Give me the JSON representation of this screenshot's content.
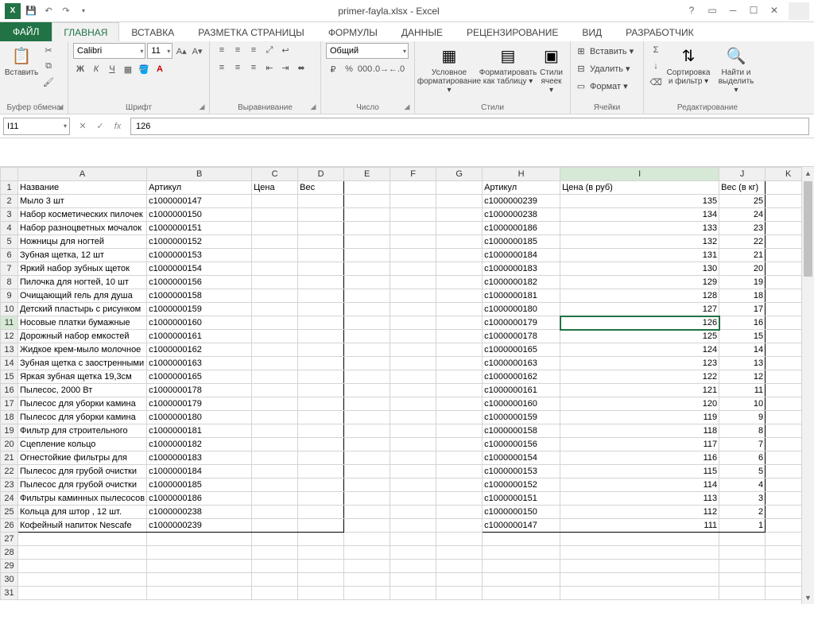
{
  "title": "primer-fayla.xlsx - Excel",
  "tabs": {
    "file": "ФАЙЛ",
    "list": [
      "ГЛАВНАЯ",
      "ВСТАВКА",
      "РАЗМЕТКА СТРАНИЦЫ",
      "ФОРМУЛЫ",
      "ДАННЫЕ",
      "РЕЦЕНЗИРОВАНИЕ",
      "ВИД",
      "РАЗРАБОТЧИК"
    ],
    "active": 0
  },
  "ribbon": {
    "clipboard": {
      "paste": "Вставить",
      "title": "Буфер обмена"
    },
    "font": {
      "name": "Calibri",
      "size": "11",
      "title": "Шрифт"
    },
    "align": {
      "title": "Выравнивание"
    },
    "number": {
      "format": "Общий",
      "title": "Число"
    },
    "styles": {
      "cond": "Условное форматирование ▾",
      "table": "Форматировать как таблицу ▾",
      "cell": "Стили ячеек ▾",
      "title": "Стили"
    },
    "cells": {
      "insert": "Вставить ▾",
      "delete": "Удалить ▾",
      "format": "Формат ▾",
      "title": "Ячейки"
    },
    "editing": {
      "sort": "Сортировка и фильтр ▾",
      "find": "Найти и выделить ▾",
      "title": "Редактирование"
    }
  },
  "namebox": "I11",
  "formula": "126",
  "columns": [
    "A",
    "B",
    "C",
    "D",
    "E",
    "F",
    "G",
    "H",
    "I",
    "J",
    "K"
  ],
  "headers1": {
    "A": "Название",
    "B": "Артикул",
    "C": "Цена",
    "D": "Вес"
  },
  "headers2": {
    "H": "Артикул",
    "I": "Цена (в руб)",
    "J": "Вес (в кг)"
  },
  "left_rows": [
    [
      "Мыло 3 шт",
      "c1000000147"
    ],
    [
      "Набор косметических пилочек",
      "c1000000150"
    ],
    [
      "Набор разноцветных мочалок",
      "c1000000151"
    ],
    [
      "Ножницы для ногтей",
      "c1000000152"
    ],
    [
      "Зубная щетка, 12 шт",
      "c1000000153"
    ],
    [
      "Яркий набор зубных щеток",
      "c1000000154"
    ],
    [
      "Пилочка для ногтей, 10 шт",
      "c1000000156"
    ],
    [
      "Очищающий гель для душа",
      "c1000000158"
    ],
    [
      "Детский пластырь с рисунком",
      "c1000000159"
    ],
    [
      "Носовые платки бумажные",
      "c1000000160"
    ],
    [
      "Дорожный набор емкостей",
      "c1000000161"
    ],
    [
      "Жидкое крем-мыло молочное",
      "c1000000162"
    ],
    [
      "Зубная щетка с заостренными",
      "c1000000163"
    ],
    [
      "Яркая зубная щетка 19,3см",
      "c1000000165"
    ],
    [
      "Пылесос, 2000 Вт",
      "c1000000178"
    ],
    [
      "Пылесос для уборки камина",
      "c1000000179"
    ],
    [
      "Пылесос для уборки камина",
      "c1000000180"
    ],
    [
      "Фильтр для строительного",
      "c1000000181"
    ],
    [
      "Сцепление кольцо",
      "c1000000182"
    ],
    [
      "Огнестойкие фильтры для",
      "c1000000183"
    ],
    [
      "Пылесос для грубой очистки",
      "c1000000184"
    ],
    [
      "Пылесос для грубой очистки",
      "c1000000185"
    ],
    [
      "Фильтры каминных пылесосов",
      "c1000000186"
    ],
    [
      "Кольца для штор , 12 шт.",
      "c1000000238"
    ],
    [
      "Кофейный напиток Nescafe",
      "c1000000239"
    ]
  ],
  "right_rows": [
    [
      "c1000000239",
      135,
      25
    ],
    [
      "c1000000238",
      134,
      24
    ],
    [
      "c1000000186",
      133,
      23
    ],
    [
      "c1000000185",
      132,
      22
    ],
    [
      "c1000000184",
      131,
      21
    ],
    [
      "c1000000183",
      130,
      20
    ],
    [
      "c1000000182",
      129,
      19
    ],
    [
      "c1000000181",
      128,
      18
    ],
    [
      "c1000000180",
      127,
      17
    ],
    [
      "c1000000179",
      126,
      16
    ],
    [
      "c1000000178",
      125,
      15
    ],
    [
      "c1000000165",
      124,
      14
    ],
    [
      "c1000000163",
      123,
      13
    ],
    [
      "c1000000162",
      122,
      12
    ],
    [
      "c1000000161",
      121,
      11
    ],
    [
      "c1000000160",
      120,
      10
    ],
    [
      "c1000000159",
      119,
      9
    ],
    [
      "c1000000158",
      118,
      8
    ],
    [
      "c1000000156",
      117,
      7
    ],
    [
      "c1000000154",
      116,
      6
    ],
    [
      "c1000000153",
      115,
      5
    ],
    [
      "c1000000152",
      114,
      4
    ],
    [
      "c1000000151",
      113,
      3
    ],
    [
      "c1000000150",
      112,
      2
    ],
    [
      "c1000000147",
      111,
      1
    ]
  ],
  "total_rows": 31,
  "active_cell": {
    "row": 11,
    "col": "I"
  }
}
